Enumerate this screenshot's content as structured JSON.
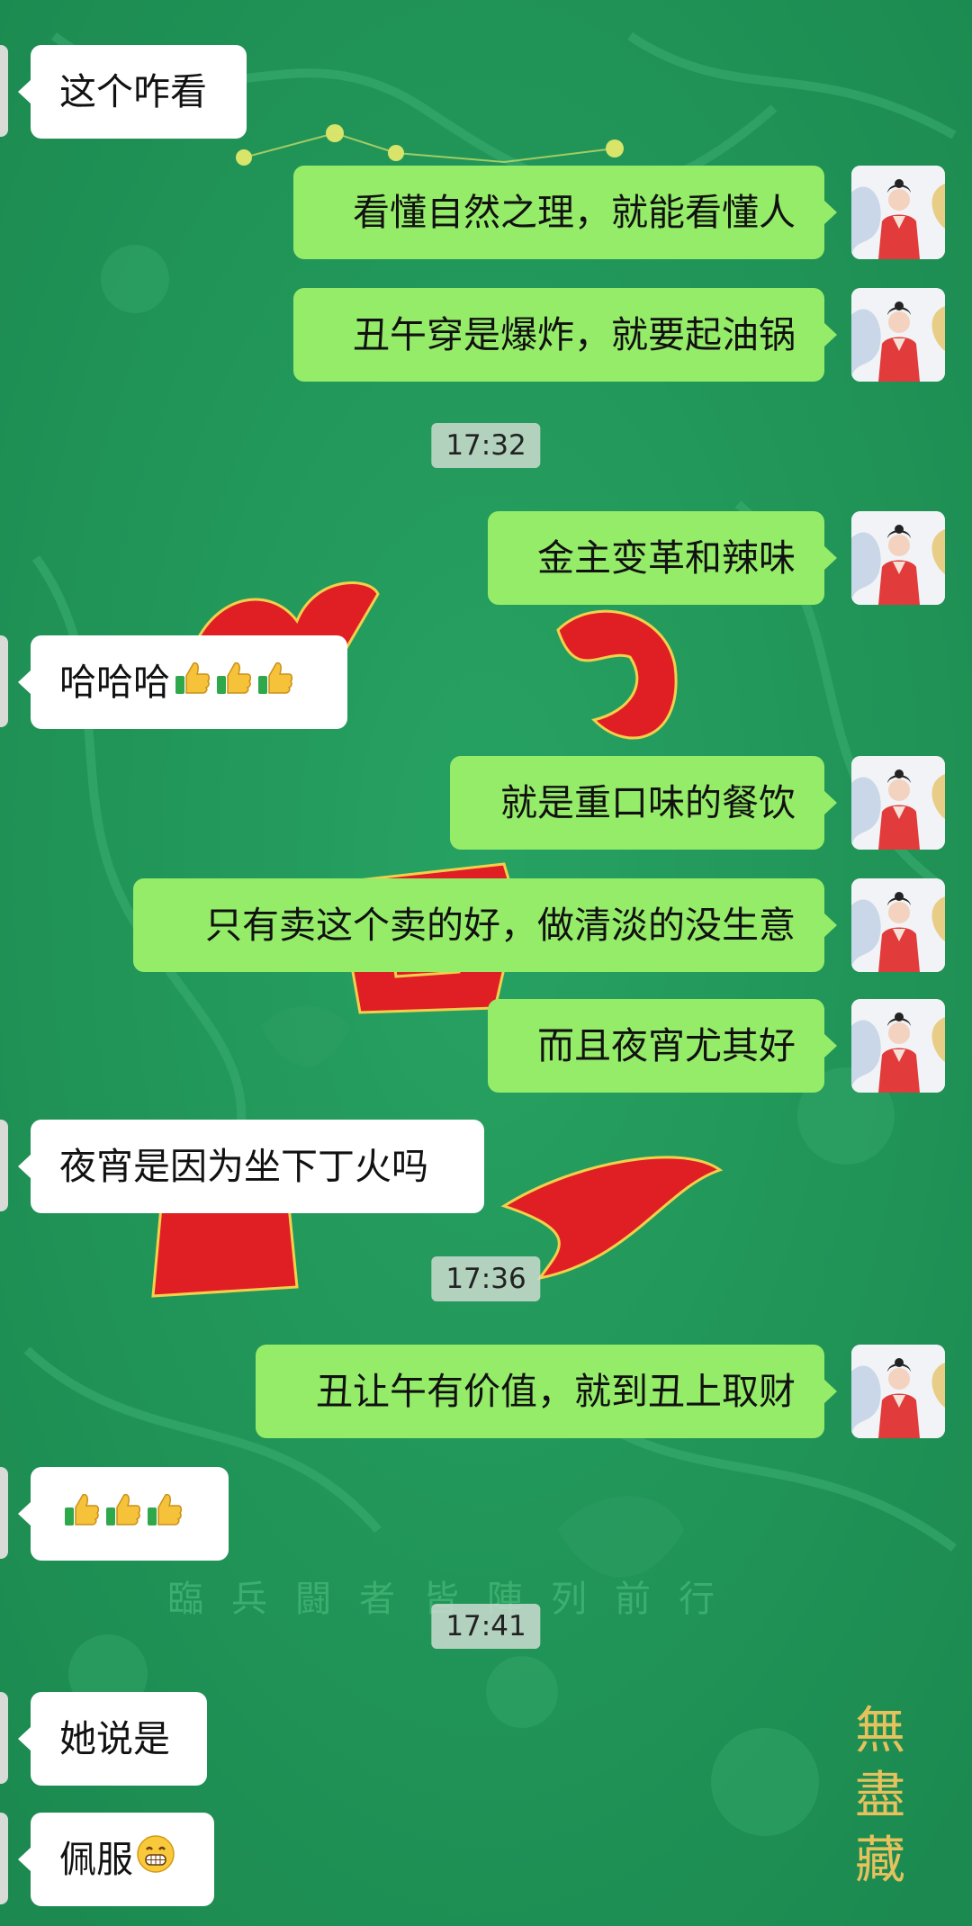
{
  "colors": {
    "wallpaper": "#21955a",
    "incoming_bubble": "#ffffff",
    "outgoing_bubble": "#95ec69",
    "timestamp_pill": "#d2ded4",
    "text": "#111111"
  },
  "wallpaper": {
    "watermark_line": "臨兵闘者皆陣列前行",
    "corner_seal": "無盡藏"
  },
  "chat": {
    "messages": [
      {
        "text": "这个咋看",
        "from": "peer"
      },
      {
        "text": "看懂自然之理，就能看懂人",
        "from": "me"
      },
      {
        "text": "丑午穿是爆炸，就要起油锅",
        "from": "me"
      },
      {
        "time": "17:32"
      },
      {
        "text": "金主变革和辣味",
        "from": "me"
      },
      {
        "text": "哈哈哈",
        "from": "peer",
        "emoji": "thumbs-up-icon x3"
      },
      {
        "text": "就是重口味的餐饮",
        "from": "me"
      },
      {
        "text": "只有卖这个卖的好，做清淡的没生意",
        "from": "me"
      },
      {
        "text": "而且夜宵尤其好",
        "from": "me"
      },
      {
        "text": "夜宵是因为坐下丁火吗",
        "from": "peer"
      },
      {
        "time": "17:36"
      },
      {
        "text": "丑让午有价值，就到丑上取财",
        "from": "me"
      },
      {
        "text": "",
        "from": "peer",
        "emoji": "thumbs-up-icon x3"
      },
      {
        "time": "17:41"
      },
      {
        "text": "她说是",
        "from": "peer"
      },
      {
        "text": "佩服",
        "from": "peer",
        "emoji": "grinning-face-icon"
      }
    ]
  }
}
